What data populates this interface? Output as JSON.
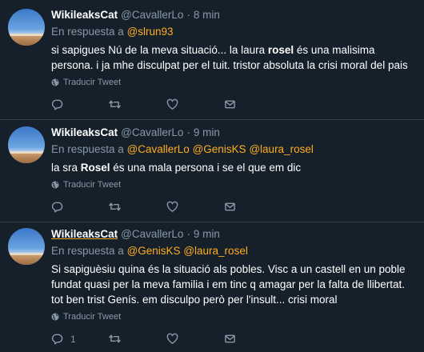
{
  "tweets": [
    {
      "name": "WikileaksCat",
      "handle": "@CavallerLo",
      "sep": "·",
      "time": "8 min",
      "reply_prefix": "En respuesta a",
      "mentions": [
        "@slrun93"
      ],
      "body_parts": [
        {
          "text": "si sapigues Nú de la meva situació... la laura ",
          "bold": false
        },
        {
          "text": "rosel",
          "bold": true
        },
        {
          "text": " és una malisima persona. i ja mhe disculpat per el tuit. tristor absoluta la crisi moral del pais",
          "bold": false
        }
      ],
      "translate": "Traducir Tweet",
      "reply_count": ""
    },
    {
      "name": "WikileaksCat",
      "handle": "@CavallerLo",
      "sep": "·",
      "time": "9 min",
      "reply_prefix": "En respuesta a",
      "mentions": [
        "@CavallerLo",
        "@GenisKS",
        "@laura_rosel"
      ],
      "body_parts": [
        {
          "text": "la sra ",
          "bold": false
        },
        {
          "text": "Rosel",
          "bold": true
        },
        {
          "text": " és una mala persona i se el que em dic",
          "bold": false
        }
      ],
      "translate": "Traducir Tweet",
      "reply_count": ""
    },
    {
      "name": "WikileaksCat",
      "handle": "@CavallerLo",
      "sep": "·",
      "time": "9 min",
      "reply_prefix": "En respuesta a",
      "mentions": [
        "@GenisKS",
        "@laura_rosel"
      ],
      "body_parts": [
        {
          "text": "Si sapiguèsiu quina és la situació als pobles. Visc a un castell en un poble fundat quasi per la meva familia i em tinc q amagar per la falta de llibertat. tot ben trist Genís. em disculpo però per l'insult... crisi moral",
          "bold": false
        }
      ],
      "translate": "Traducir Tweet",
      "reply_count": "1"
    }
  ],
  "colors": {
    "background": "#15202b",
    "mention": "#ffad1f",
    "muted": "#8899a6",
    "divider": "#38444d"
  },
  "icons": [
    "globe-icon",
    "reply-icon",
    "retweet-icon",
    "like-icon",
    "message-icon"
  ]
}
